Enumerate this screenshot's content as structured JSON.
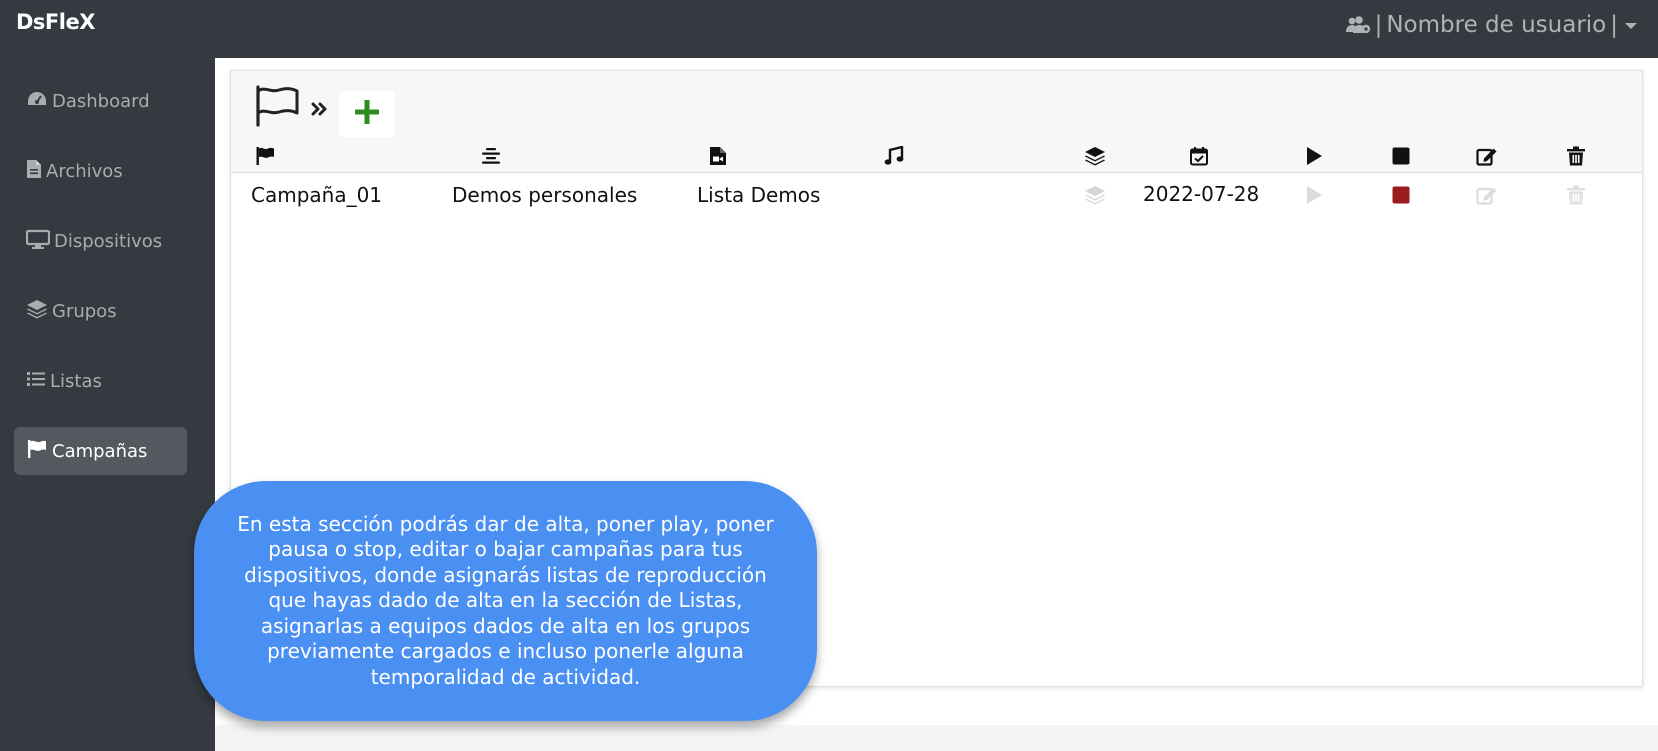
{
  "app": {
    "brand": "DsFleX"
  },
  "user_menu": {
    "separator_left": "|",
    "username": "Nombre de usuario",
    "separator_right": "|",
    "icon": "users-cog-icon",
    "caret": "caret-down-icon"
  },
  "sidebar": {
    "items": [
      {
        "label": "Dashboard",
        "icon": "tachometer-icon",
        "active": false
      },
      {
        "label": "Archivos",
        "icon": "file-icon",
        "active": false
      },
      {
        "label": "Dispositivos",
        "icon": "desktop-icon",
        "active": false
      },
      {
        "label": "Grupos",
        "icon": "layers-icon",
        "active": false
      },
      {
        "label": "Listas",
        "icon": "list-icon",
        "active": false
      },
      {
        "label": "Campañas",
        "icon": "flag-icon",
        "active": true
      }
    ]
  },
  "breadcrumb": {
    "section_icon": "flag-outline-icon",
    "separator": "»",
    "add_icon": "plus-icon"
  },
  "table": {
    "column_icons": [
      "flag-icon",
      "align-center-icon",
      "file-video-icon",
      "music-icon",
      "layers-icon",
      "calendar-check-icon",
      "play-icon",
      "stop-icon",
      "edit-icon",
      "trash-icon"
    ],
    "rows": [
      {
        "campaign": "Campaña_01",
        "description": "Demos personales",
        "list": "Lista Demos",
        "audio": "",
        "date": "2022-07-28"
      }
    ]
  },
  "tooltip": {
    "text": "En esta sección podrás dar de alta, poner play, poner pausa o stop, editar o bajar campañas para tus dispositivos, donde asignarás listas de reproducción que hayas dado de alta en la sección de Listas, asignarlas a equipos dados de alta en los grupos previamente cargados e incluso ponerle alguna temporalidad de actividad."
  },
  "colors": {
    "topbar": "#343a40",
    "active_nav": "#53595f",
    "add_green": "#2e8b1f",
    "stop_red": "#9b1c1c",
    "tooltip_blue": "#4a8ff2",
    "disabled_icon": "#d6d6d6"
  }
}
